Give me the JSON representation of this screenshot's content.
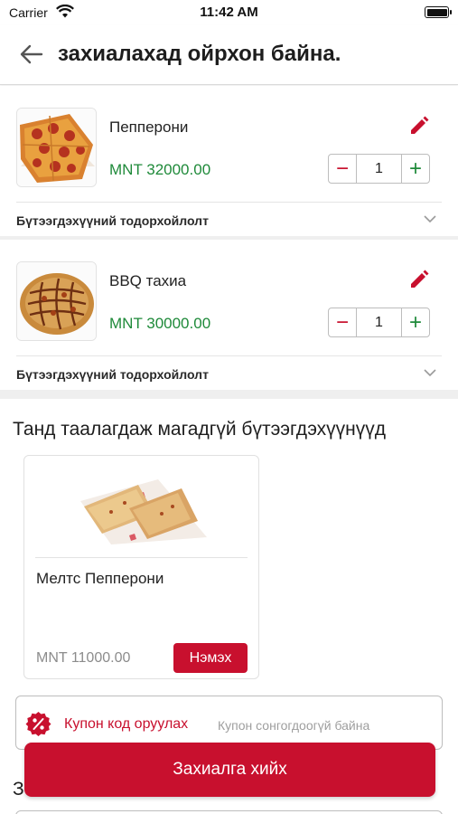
{
  "status_bar": {
    "carrier": "Carrier",
    "time": "11:42 AM"
  },
  "header": {
    "title": "захиалахад ойрхон байна."
  },
  "cart": {
    "items": [
      {
        "name": "Пепперони",
        "price": "MNT 32000.00",
        "quantity": "1",
        "description_label": "Бүтээгдэхүүний тодорхойлолт",
        "image": "pepperoni-pizza"
      },
      {
        "name": "BBQ тахиа",
        "price": "MNT 30000.00",
        "quantity": "1",
        "description_label": "Бүтээгдэхүүний тодорхойлолт",
        "image": "bbq-chicken-pizza"
      }
    ],
    "minus_symbol": "−",
    "plus_symbol": "+"
  },
  "recommendations": {
    "heading": "Танд таалагдаж магадгүй бүтээгдэхүүнүүд",
    "items": [
      {
        "name": "Мелтс Пепперони",
        "price": "MNT 11000.00",
        "add_label": "Нэмэх",
        "image": "melts-pepperoni"
      }
    ]
  },
  "coupon": {
    "label": "Купон код оруулах",
    "hint": "Купон сонгогдоогүй байна",
    "icon": "percent-icon"
  },
  "next_section_peek": "З",
  "checkout": {
    "label": "Захиалга хийх"
  },
  "colors": {
    "accent": "#c8102e",
    "price_green": "#1f8a3a"
  }
}
